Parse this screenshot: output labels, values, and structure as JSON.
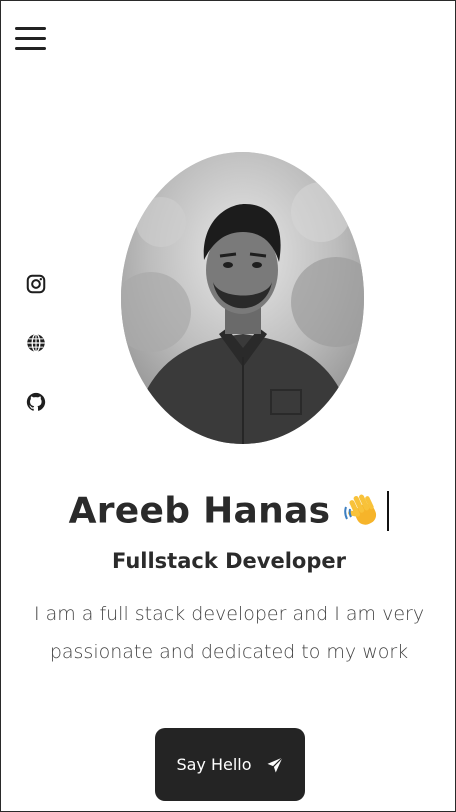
{
  "header": {
    "menu_icon": "hamburger-menu-icon"
  },
  "socials": [
    {
      "icon": "instagram-icon"
    },
    {
      "icon": "globe-icon"
    },
    {
      "icon": "github-icon"
    }
  ],
  "profile": {
    "name": "Areeb Hanas",
    "emoji": "👋",
    "role": "Fullstack Developer",
    "bio": "I am a full stack developer and I am very passionate and dedicated to my work"
  },
  "cta": {
    "label": "Say Hello",
    "icon": "send-icon"
  },
  "colors": {
    "text": "#2a2a2a",
    "button_bg": "#242424",
    "button_text": "#ffffff"
  }
}
